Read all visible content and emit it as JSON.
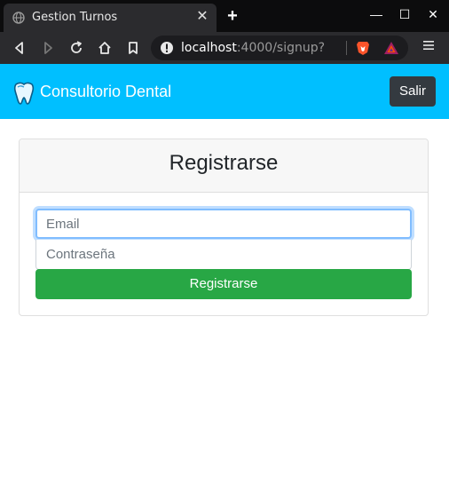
{
  "browser": {
    "tab_title": "Gestion Turnos",
    "tab_close": "✕",
    "new_tab": "+",
    "window_controls": {
      "minimize": "—",
      "maximize": "☐",
      "close": "✕"
    },
    "url_host": "localhost",
    "url_path": ":4000/signup?",
    "icons": [
      "globe-icon",
      "back-icon",
      "forward-icon",
      "reload-icon",
      "home-icon",
      "bookmark-icon",
      "info-icon",
      "brave-shield-icon",
      "bat-rewards-icon",
      "menu-icon"
    ]
  },
  "navbar": {
    "brand": "Consultorio Dental",
    "logout_label": "Salir",
    "color": "#00bfff"
  },
  "form": {
    "title": "Registrarse",
    "email_placeholder": "Email",
    "password_placeholder": "Contraseña",
    "submit_label": "Registrarse",
    "submit_color": "#28a745"
  }
}
